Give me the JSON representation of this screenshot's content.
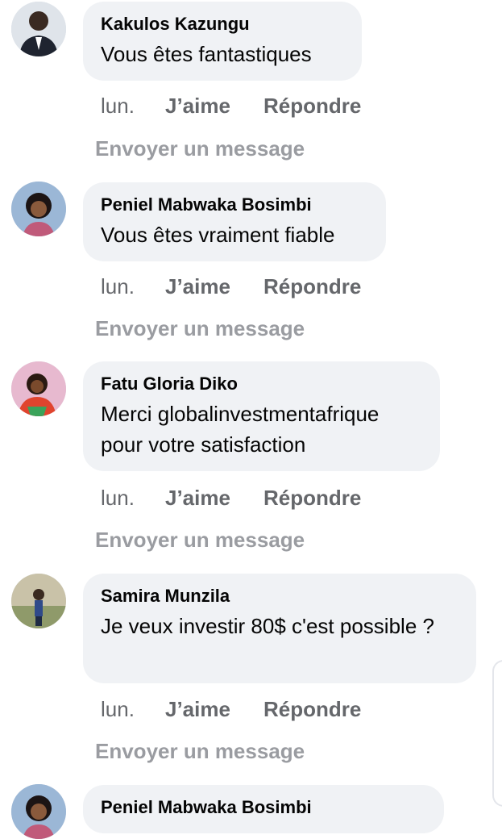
{
  "comments": [
    {
      "author": "Kakulos Kazungu",
      "text": "Vous êtes fantastiques",
      "time": "lun.",
      "like": "J’aime",
      "reply": "Répondre",
      "message": "Envoyer un message"
    },
    {
      "author": "Peniel Mabwaka Bosimbi",
      "text": "Vous êtes vraiment fiable",
      "time": "lun.",
      "like": "J’aime",
      "reply": "Répondre",
      "message": "Envoyer un message"
    },
    {
      "author": "Fatu Gloria Diko",
      "text": "Merci globalinvestmentafrique pour votre satisfaction",
      "time": "lun.",
      "like": "J’aime",
      "reply": "Répondre",
      "message": "Envoyer un message"
    },
    {
      "author": "Samira Munzila",
      "text": "Je veux investir 80$ c'est possible ?",
      "time": "lun.",
      "like": "J’aime",
      "reply": "Répondre",
      "message": "Envoyer un message"
    },
    {
      "author": "Peniel Mabwaka Bosimbi"
    }
  ]
}
